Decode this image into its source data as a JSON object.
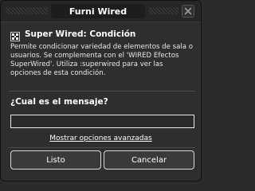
{
  "window": {
    "title": "Furni Wired",
    "close_icon": "close-icon"
  },
  "header": {
    "icon": "wired-condition-icon",
    "title": "Super Wired: Condición"
  },
  "description": "Permite condicionar variedad de elementos de sala o usuarios. Se complementa con el 'WIRED Efectos SuperWired'. Utiliza :superwired para ver las opciones de esta condición.",
  "form": {
    "question": "¿Cual es el mensaje?",
    "message_value": "",
    "advanced_link": "Mostrar opciones avanzadas"
  },
  "buttons": {
    "ok_label": "Listo",
    "cancel_label": "Cancelar"
  },
  "colors": {
    "background": "#2e2e2e",
    "titlebar": "#262626",
    "text": "#ffffff"
  }
}
